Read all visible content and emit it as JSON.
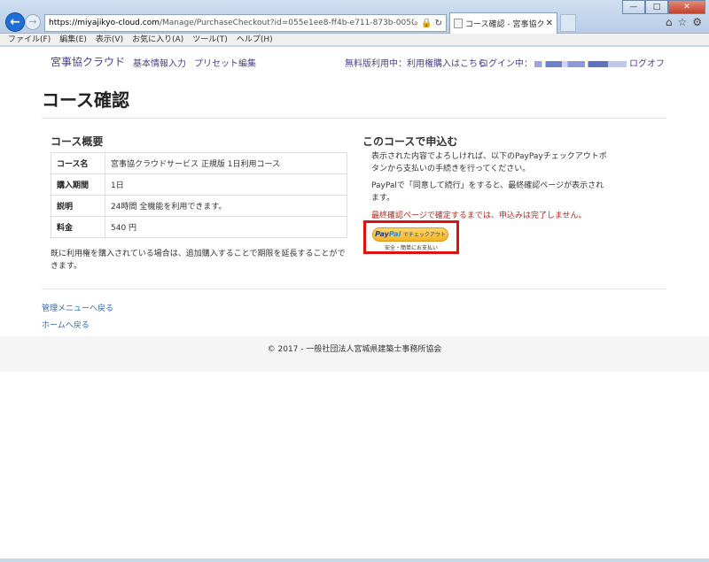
{
  "browser": {
    "url_host": "https://miyajikyo-cloud.com",
    "url_path": "/Manage/PurchaseCheckout?id=055e1ee8-ff4b-e711-873b-005056c00008",
    "tab_title": "コース確認 - 宮事協クラ...",
    "menu": [
      "ファイル(F)",
      "編集(E)",
      "表示(V)",
      "お気に入り(A)",
      "ツール(T)",
      "ヘルプ(H)"
    ]
  },
  "navbar": {
    "brand": "宮事協クラウド",
    "basic_info": "基本情報入力",
    "preset": "プリセット編集",
    "trial_notice": "無料版利用中：利用権購入はこちら",
    "login_label": "ログイン中：",
    "logout": "ログオフ"
  },
  "page": {
    "title": "コース確認",
    "overview_title": "コース概要",
    "apply_title": "このコースで申込む"
  },
  "course": {
    "rows": [
      {
        "key": "コース名",
        "value": "宮事協クラウドサービス 正規版 1日利用コース"
      },
      {
        "key": "購入期間",
        "value": "1日"
      },
      {
        "key": "説明",
        "value": "24時間 全機能を利用できます。"
      },
      {
        "key": "料金",
        "value": "540 円"
      }
    ],
    "note": "既に利用権を購入されている場合は、追加購入することで期限を延長することができます。"
  },
  "apply": {
    "desc1": "表示された内容でよろしければ、以下のPayPayチェックアウトボタンから支払いの手続きを行ってください。",
    "desc2": "PayPalで「同意して続行」をすると、最終確認ページが表示されます。",
    "warning": "最終確認ページで確定するまでは、申込みは完了しません。",
    "paypal_suffix": "でチェックアウト",
    "paypal_sub": "安全・簡単にお支払い"
  },
  "links": {
    "management_menu": "管理メニューへ戻る",
    "home": "ホームへ戻る"
  },
  "footer": {
    "copyright": "© 2017 - 一般社団法人宮城県建築士事務所協会"
  },
  "colors": {
    "brand": "#4a3f8f",
    "link": "#2d67b6",
    "warning": "#b12a1e",
    "highlight": "#e01010"
  }
}
